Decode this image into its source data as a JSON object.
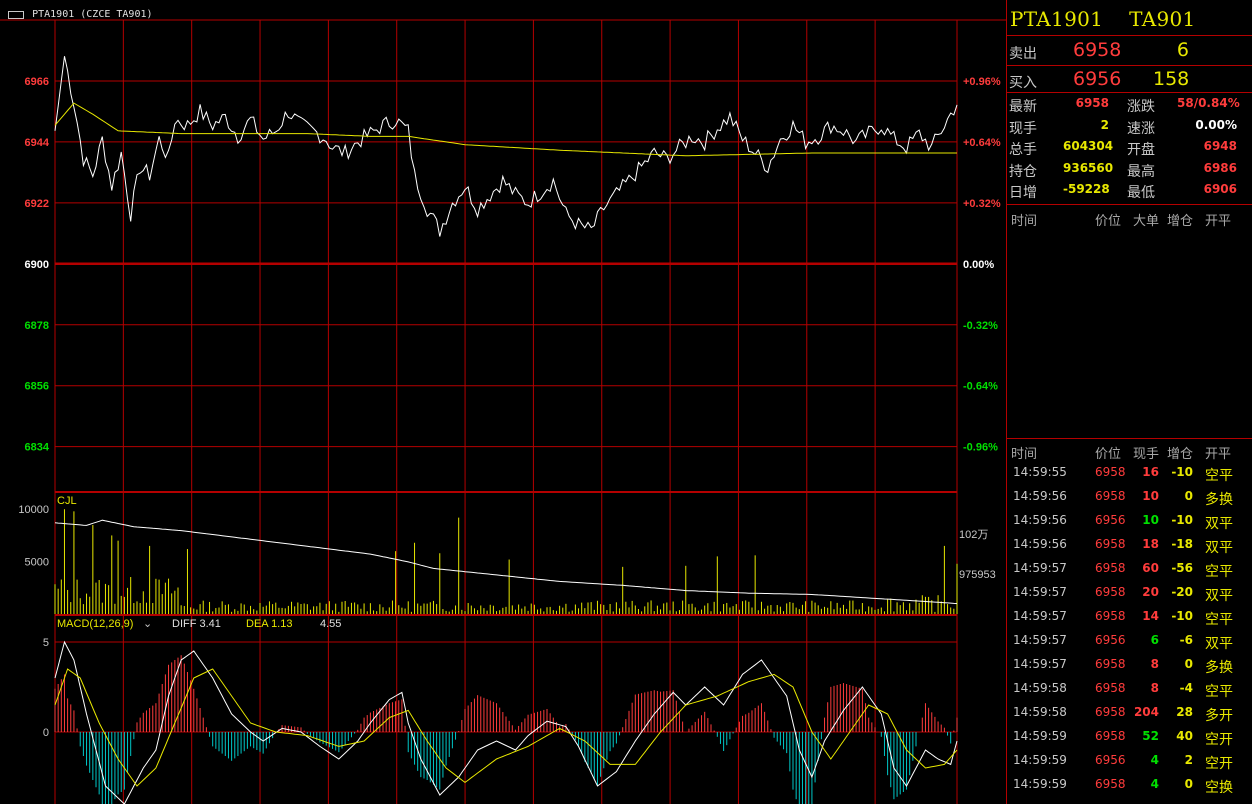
{
  "chart_header": {
    "icon": "chart-window-icon",
    "title": "PTA1901 (CZCE TA901)"
  },
  "colors": {
    "up": "#ff3c3c",
    "down": "#00e000",
    "neutral": "#ffffff",
    "grid": "#b40000",
    "price_line": "#ffffff",
    "avg_line": "#e8e800",
    "yellow": "#e8e800",
    "cyan": "#00c8c8"
  },
  "quote": {
    "code1": "PTA1901",
    "code2": "TA901",
    "ask_label": "卖出",
    "ask_price": "6958",
    "ask_vol": "6",
    "bid_label": "买入",
    "bid_price": "6956",
    "bid_vol": "158",
    "stats": [
      {
        "l1": "最新",
        "v1": "6958",
        "c1": "up",
        "l2": "涨跌",
        "v2": "58/0.84%",
        "c2": "up"
      },
      {
        "l1": "现手",
        "v1": "2",
        "c1": "yellow",
        "l2": "速涨",
        "v2": "0.00%",
        "c2": "neutral"
      },
      {
        "l1": "总手",
        "v1": "604304",
        "c1": "yellow",
        "l2": "开盘",
        "v2": "6948",
        "c2": "up"
      },
      {
        "l1": "持仓",
        "v1": "936560",
        "c1": "yellow",
        "l2": "最高",
        "v2": "6986",
        "c2": "up"
      },
      {
        "l1": "日增",
        "v1": "-59228",
        "c1": "yellow",
        "l2": "最低",
        "v2": "6906",
        "c2": "up"
      }
    ]
  },
  "bigorder_headers": [
    "时间",
    "价位",
    "大单",
    "增仓",
    "开平"
  ],
  "tick_headers": [
    "时间",
    "价位",
    "现手",
    "增仓",
    "开平"
  ],
  "ticks": [
    {
      "time": "14:59:55",
      "price": "6958",
      "pc": "up",
      "vol": "16",
      "vc": "up",
      "oi": "-10",
      "oc": "yellow",
      "type": "空平",
      "tc": "yellow"
    },
    {
      "time": "14:59:56",
      "price": "6958",
      "pc": "up",
      "vol": "10",
      "vc": "up",
      "oi": "0",
      "oc": "yellow",
      "type": "多换",
      "tc": "yellow"
    },
    {
      "time": "14:59:56",
      "price": "6956",
      "pc": "up",
      "vol": "10",
      "vc": "down",
      "oi": "-10",
      "oc": "yellow",
      "type": "双平",
      "tc": "yellow"
    },
    {
      "time": "14:59:56",
      "price": "6958",
      "pc": "up",
      "vol": "18",
      "vc": "up",
      "oi": "-18",
      "oc": "yellow",
      "type": "双平",
      "tc": "yellow"
    },
    {
      "time": "14:59:57",
      "price": "6958",
      "pc": "up",
      "vol": "60",
      "vc": "up",
      "oi": "-56",
      "oc": "yellow",
      "type": "空平",
      "tc": "yellow"
    },
    {
      "time": "14:59:57",
      "price": "6958",
      "pc": "up",
      "vol": "20",
      "vc": "up",
      "oi": "-20",
      "oc": "yellow",
      "type": "双平",
      "tc": "yellow"
    },
    {
      "time": "14:59:57",
      "price": "6958",
      "pc": "up",
      "vol": "14",
      "vc": "up",
      "oi": "-10",
      "oc": "yellow",
      "type": "空平",
      "tc": "yellow"
    },
    {
      "time": "14:59:57",
      "price": "6956",
      "pc": "up",
      "vol": "6",
      "vc": "down",
      "oi": "-6",
      "oc": "yellow",
      "type": "双平",
      "tc": "yellow"
    },
    {
      "time": "14:59:57",
      "price": "6958",
      "pc": "up",
      "vol": "8",
      "vc": "up",
      "oi": "0",
      "oc": "yellow",
      "type": "多换",
      "tc": "yellow"
    },
    {
      "time": "14:59:58",
      "price": "6958",
      "pc": "up",
      "vol": "8",
      "vc": "up",
      "oi": "-4",
      "oc": "yellow",
      "type": "空平",
      "tc": "yellow"
    },
    {
      "time": "14:59:58",
      "price": "6958",
      "pc": "up",
      "vol": "204",
      "vc": "up",
      "oi": "28",
      "oc": "yellow",
      "type": "多开",
      "tc": "yellow"
    },
    {
      "time": "14:59:59",
      "price": "6958",
      "pc": "up",
      "vol": "52",
      "vc": "down",
      "oi": "40",
      "oc": "yellow",
      "type": "空开",
      "tc": "yellow"
    },
    {
      "time": "14:59:59",
      "price": "6956",
      "pc": "up",
      "vol": "4",
      "vc": "down",
      "oi": "2",
      "oc": "yellow",
      "type": "空开",
      "tc": "yellow"
    },
    {
      "time": "14:59:59",
      "price": "6958",
      "pc": "up",
      "vol": "4",
      "vc": "down",
      "oi": "0",
      "oc": "yellow",
      "type": "空换",
      "tc": "yellow"
    }
  ],
  "chart_data": [
    {
      "type": "line",
      "name": "intraday-price",
      "prev_close": 6900,
      "ylim": [
        6818,
        6988
      ],
      "ytick_values": [
        6966,
        6944,
        6922,
        6900,
        6878,
        6856,
        6834
      ],
      "pct_labels": [
        "+0.96%",
        "+0.64%",
        "+0.32%",
        "0.00%",
        "-0.32%",
        "-0.64%",
        "-0.96%"
      ],
      "price_keypoints": [
        [
          0,
          6948
        ],
        [
          3,
          6975
        ],
        [
          6,
          6958
        ],
        [
          9,
          6938
        ],
        [
          12,
          6932
        ],
        [
          15,
          6945
        ],
        [
          18,
          6928
        ],
        [
          21,
          6940
        ],
        [
          24,
          6918
        ],
        [
          27,
          6935
        ],
        [
          30,
          6932
        ],
        [
          33,
          6945
        ],
        [
          36,
          6938
        ],
        [
          38,
          6952
        ],
        [
          42,
          6950
        ],
        [
          46,
          6955
        ],
        [
          50,
          6950
        ],
        [
          54,
          6953
        ],
        [
          58,
          6946
        ],
        [
          62,
          6952
        ],
        [
          66,
          6945
        ],
        [
          70,
          6948
        ],
        [
          74,
          6955
        ],
        [
          78,
          6950
        ],
        [
          82,
          6948
        ],
        [
          86,
          6945
        ],
        [
          88,
          6942
        ],
        [
          92,
          6940
        ],
        [
          96,
          6944
        ],
        [
          100,
          6947
        ],
        [
          104,
          6950
        ],
        [
          108,
          6952
        ],
        [
          112,
          6948
        ],
        [
          114,
          6932
        ],
        [
          118,
          6920
        ],
        [
          122,
          6912
        ],
        [
          126,
          6922
        ],
        [
          130,
          6928
        ],
        [
          134,
          6920
        ],
        [
          138,
          6925
        ],
        [
          142,
          6930
        ],
        [
          146,
          6925
        ],
        [
          150,
          6922
        ],
        [
          154,
          6926
        ],
        [
          158,
          6930
        ],
        [
          162,
          6918
        ],
        [
          166,
          6914
        ],
        [
          170,
          6912
        ],
        [
          174,
          6920
        ],
        [
          178,
          6925
        ],
        [
          182,
          6930
        ],
        [
          186,
          6935
        ],
        [
          190,
          6940
        ],
        [
          194,
          6938
        ],
        [
          198,
          6942
        ],
        [
          202,
          6946
        ],
        [
          206,
          6944
        ],
        [
          210,
          6949
        ],
        [
          214,
          6953
        ],
        [
          218,
          6945
        ],
        [
          222,
          6940
        ],
        [
          226,
          6935
        ],
        [
          230,
          6945
        ],
        [
          234,
          6950
        ],
        [
          238,
          6944
        ],
        [
          242,
          6946
        ],
        [
          246,
          6950
        ],
        [
          250,
          6948
        ],
        [
          254,
          6944
        ],
        [
          258,
          6947
        ],
        [
          262,
          6950
        ],
        [
          266,
          6945
        ],
        [
          270,
          6942
        ],
        [
          274,
          6947
        ],
        [
          278,
          6942
        ],
        [
          282,
          6950
        ],
        [
          286,
          6958
        ]
      ],
      "avg_keypoints": [
        [
          0,
          6950
        ],
        [
          6,
          6958
        ],
        [
          12,
          6954
        ],
        [
          20,
          6948
        ],
        [
          40,
          6947
        ],
        [
          60,
          6947
        ],
        [
          80,
          6947
        ],
        [
          100,
          6946
        ],
        [
          112,
          6946
        ],
        [
          130,
          6943
        ],
        [
          160,
          6941
        ],
        [
          200,
          6939
        ],
        [
          240,
          6940
        ],
        [
          286,
          6940
        ]
      ],
      "n_minutes": 287
    },
    {
      "type": "bar",
      "name": "volume",
      "label": "CJL",
      "ytick_values": [
        10000,
        5000
      ],
      "ylim": [
        0,
        10500
      ],
      "right_labels": [
        "102万",
        "975953"
      ],
      "spike_minutes": [
        [
          3,
          10000
        ],
        [
          6,
          9800
        ],
        [
          12,
          8500
        ],
        [
          18,
          7500
        ],
        [
          20,
          7000
        ],
        [
          30,
          6500
        ],
        [
          42,
          6200
        ],
        [
          108,
          6000
        ],
        [
          114,
          6800
        ],
        [
          122,
          5800
        ],
        [
          128,
          9200
        ],
        [
          144,
          5200
        ],
        [
          180,
          4500
        ],
        [
          200,
          4600
        ],
        [
          210,
          5500
        ],
        [
          222,
          5600
        ],
        [
          282,
          6500
        ],
        [
          286,
          4800
        ]
      ],
      "oi_line_keypoints": [
        [
          0,
          7000
        ],
        [
          10,
          6800
        ],
        [
          15,
          7200
        ],
        [
          25,
          6700
        ],
        [
          40,
          6400
        ],
        [
          60,
          5800
        ],
        [
          80,
          5200
        ],
        [
          100,
          4600
        ],
        [
          112,
          4000
        ],
        [
          120,
          3500
        ],
        [
          140,
          3000
        ],
        [
          160,
          2500
        ],
        [
          180,
          2200
        ],
        [
          200,
          1800
        ],
        [
          220,
          1600
        ],
        [
          240,
          1500
        ],
        [
          260,
          1200
        ],
        [
          280,
          900
        ],
        [
          286,
          800
        ]
      ],
      "oi_scale": 7600
    },
    {
      "type": "bar",
      "name": "macd",
      "label": "MACD(12,26,9)",
      "diff_label": "DIFF 3.41",
      "dea_label": "DEA 1.13",
      "macd_label": "4.55",
      "ytick_values": [
        5,
        0
      ],
      "ylim": [
        -4,
        6.5
      ],
      "diff_keypoints": [
        [
          0,
          3
        ],
        [
          3,
          5
        ],
        [
          6,
          4
        ],
        [
          10,
          1
        ],
        [
          16,
          -3
        ],
        [
          22,
          -4
        ],
        [
          28,
          -2
        ],
        [
          32,
          -1
        ],
        [
          36,
          2
        ],
        [
          40,
          4
        ],
        [
          44,
          4.5
        ],
        [
          50,
          3
        ],
        [
          56,
          1
        ],
        [
          62,
          0
        ],
        [
          66,
          -0.5
        ],
        [
          72,
          0.2
        ],
        [
          78,
          0
        ],
        [
          84,
          -0.8
        ],
        [
          90,
          -1.5
        ],
        [
          96,
          -0.5
        ],
        [
          100,
          0.5
        ],
        [
          106,
          1.8
        ],
        [
          110,
          2.2
        ],
        [
          112,
          0.5
        ],
        [
          116,
          -1.5
        ],
        [
          122,
          -3.5
        ],
        [
          128,
          -2.5
        ],
        [
          134,
          -1
        ],
        [
          140,
          -0.5
        ],
        [
          146,
          -1
        ],
        [
          150,
          -0.2
        ],
        [
          156,
          0.6
        ],
        [
          162,
          0.3
        ],
        [
          166,
          -0.8
        ],
        [
          172,
          -3
        ],
        [
          178,
          -2.2
        ],
        [
          184,
          -0.5
        ],
        [
          190,
          1
        ],
        [
          196,
          2.2
        ],
        [
          200,
          1.5
        ],
        [
          206,
          2.5
        ],
        [
          212,
          1.5
        ],
        [
          218,
          3.2
        ],
        [
          224,
          4
        ],
        [
          228,
          3
        ],
        [
          232,
          2
        ],
        [
          236,
          -1
        ],
        [
          240,
          -2.5
        ],
        [
          244,
          -0.5
        ],
        [
          250,
          1.2
        ],
        [
          256,
          2.5
        ],
        [
          262,
          1
        ],
        [
          266,
          -2
        ],
        [
          270,
          -3
        ],
        [
          276,
          -1
        ],
        [
          280,
          -1.5
        ],
        [
          284,
          -1.8
        ],
        [
          286,
          -0.5
        ]
      ],
      "dea_keypoints": [
        [
          0,
          1.5
        ],
        [
          4,
          3.5
        ],
        [
          8,
          3
        ],
        [
          14,
          0.5
        ],
        [
          20,
          -1.5
        ],
        [
          26,
          -3
        ],
        [
          32,
          -2
        ],
        [
          38,
          0.5
        ],
        [
          44,
          3
        ],
        [
          50,
          3.5
        ],
        [
          56,
          2
        ],
        [
          62,
          0.5
        ],
        [
          70,
          0
        ],
        [
          80,
          -0.2
        ],
        [
          90,
          -0.8
        ],
        [
          98,
          -0.5
        ],
        [
          106,
          0.8
        ],
        [
          112,
          1.2
        ],
        [
          118,
          -0.5
        ],
        [
          124,
          -2
        ],
        [
          130,
          -2.8
        ],
        [
          140,
          -1.5
        ],
        [
          150,
          -0.8
        ],
        [
          160,
          0.2
        ],
        [
          168,
          -0.5
        ],
        [
          176,
          -1.8
        ],
        [
          184,
          -1.8
        ],
        [
          192,
          0
        ],
        [
          200,
          1.5
        ],
        [
          210,
          2
        ],
        [
          220,
          2.8
        ],
        [
          228,
          3.2
        ],
        [
          234,
          2.5
        ],
        [
          240,
          0
        ],
        [
          246,
          -1.5
        ],
        [
          252,
          0
        ],
        [
          258,
          1.5
        ],
        [
          264,
          1
        ],
        [
          270,
          -1
        ],
        [
          276,
          -2
        ],
        [
          282,
          -1.8
        ],
        [
          286,
          -1
        ]
      ]
    }
  ]
}
